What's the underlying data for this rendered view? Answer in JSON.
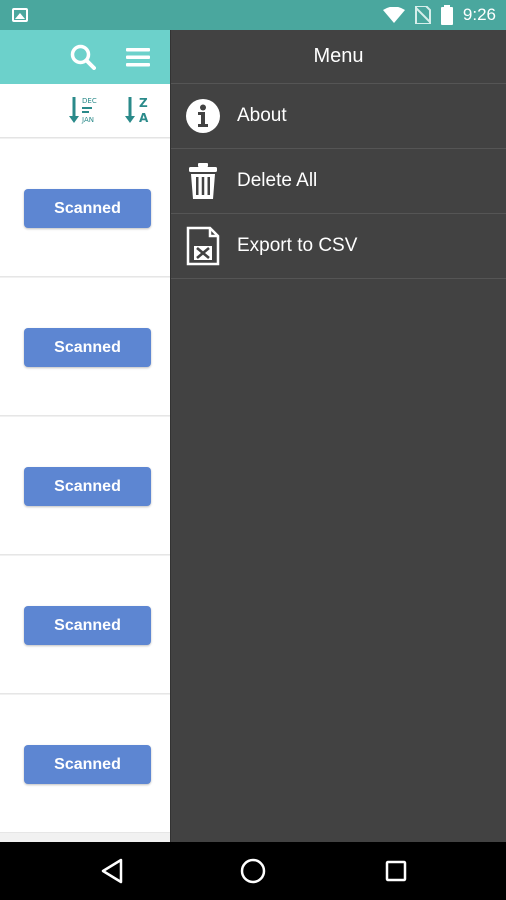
{
  "status_bar": {
    "time": "9:26",
    "icons": [
      "gallery-icon",
      "wifi-icon",
      "no-sim-icon",
      "battery-icon"
    ]
  },
  "toolbar": {
    "icons": [
      "search-icon",
      "hamburger-menu-icon"
    ]
  },
  "sort_bar": {
    "date_sort": {
      "icon": "sort-by-date-icon",
      "top": "DEC",
      "bottom": "JAN"
    },
    "alpha_sort": {
      "icon": "sort-alpha-icon",
      "top": "Z",
      "bottom": "A"
    }
  },
  "list": {
    "rows": [
      {
        "status": "Scanned"
      },
      {
        "status": "Scanned"
      },
      {
        "status": "Scanned"
      },
      {
        "status": "Scanned"
      },
      {
        "status": "Scanned"
      }
    ]
  },
  "drawer": {
    "title": "Menu",
    "items": [
      {
        "label": "About",
        "icon": "info-icon"
      },
      {
        "label": "Delete All",
        "icon": "trash-icon"
      },
      {
        "label": "Export to CSV",
        "icon": "excel-file-icon"
      }
    ]
  },
  "nav_bar": {
    "icons": [
      "back-icon",
      "home-icon",
      "recents-icon"
    ]
  },
  "colors": {
    "status_bar": "#4aa79e",
    "toolbar": "#6cd1cb",
    "scanned_button": "#5d86d2",
    "drawer_bg": "#424242",
    "sort_icon": "#2a8a8a"
  }
}
